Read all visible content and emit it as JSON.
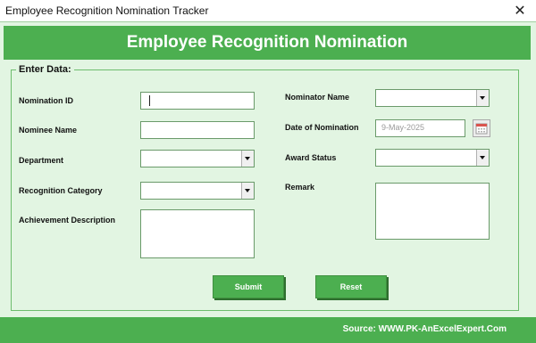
{
  "window": {
    "title": "Employee Recognition Nomination Tracker",
    "close_glyph": "✕"
  },
  "header": {
    "title": "Employee Recognition Nomination"
  },
  "group": {
    "legend": "Enter Data:"
  },
  "fields": {
    "nomination_id": {
      "label": "Nomination ID",
      "value": ""
    },
    "nominee_name": {
      "label": "Nominee Name",
      "value": ""
    },
    "department": {
      "label": "Department",
      "value": ""
    },
    "recognition_category": {
      "label": "Recognition Category",
      "value": ""
    },
    "achievement_description": {
      "label": "Achievement Description",
      "value": ""
    },
    "nominator_name": {
      "label": "Nominator Name",
      "value": ""
    },
    "date_of_nomination": {
      "label": "Date of Nomination",
      "value": "9-May-2025"
    },
    "award_status": {
      "label": "Award Status",
      "value": ""
    },
    "remark": {
      "label": "Remark",
      "value": ""
    }
  },
  "buttons": {
    "submit": "Submit",
    "reset": "Reset"
  },
  "footer": {
    "source": "Source: WWW.PK-AnExcelExpert.Com"
  },
  "colors": {
    "accent": "#4caf50",
    "form_bg": "#e2f5e2",
    "border": "#6dbd6d"
  },
  "icons": {
    "close": "close-icon",
    "dropdown": "chevron-down-icon",
    "calendar": "calendar-icon"
  }
}
